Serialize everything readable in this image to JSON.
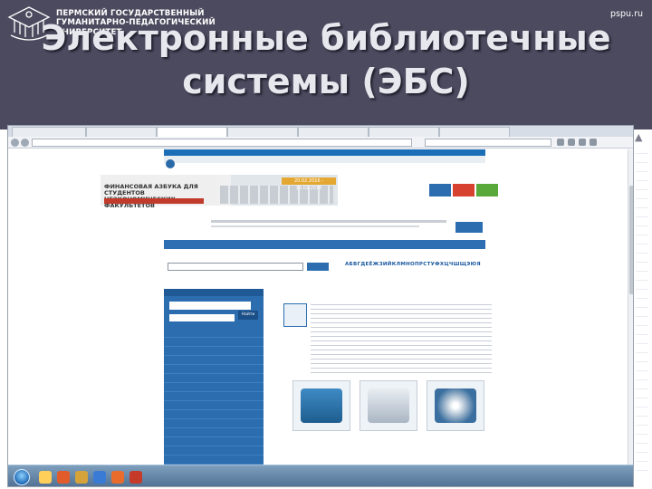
{
  "slide": {
    "university_name_lines": [
      "ПЕРМСКИЙ ГОСУДАРСТВЕННЫЙ",
      "ГУМАНИТАРНО-ПЕДАГОГИЧЕСКИЙ",
      "УНИВЕРСИТЕТ"
    ],
    "site": "pspu.ru",
    "title": "Электронные библиотечные системы (ЭБС)"
  },
  "browser": {
    "tabs": [
      "",
      "",
      "",
      "",
      "",
      "",
      ""
    ],
    "url": "",
    "search_placeholder": ""
  },
  "page": {
    "top_banner": "",
    "header_text": "",
    "event_banner": {
      "kicker": "",
      "headline": "ФИНАНСОВАЯ АЗБУКА ДЛЯ СТУДЕНТОВ НЕЭКОНОМИЧЕСКИХ ФАКУЛЬТЕТОВ",
      "dates": "20.02.2016 - 10.02.2016"
    },
    "colored_buttons": [
      "",
      "",
      ""
    ],
    "info_heading": "",
    "info_button": "",
    "main_nav_items": [
      "",
      "",
      "",
      "",
      "",
      "",
      "",
      "",
      ""
    ],
    "search": {
      "label": "",
      "button": "",
      "options": ""
    },
    "alphabet": {
      "label": "",
      "letters": "АБВГДЕЁЖЗИЙКЛМНОПРСТУФХЦЧШЩЭЮЯ",
      "tabs": ""
    },
    "left_panel": {
      "header": "",
      "search_value": "",
      "select_value": "",
      "button": "Найти",
      "items": [
        "",
        "",
        "",
        "",
        "",
        "",
        "",
        "",
        "",
        "",
        "",
        "",
        "",
        "",
        "",
        "",
        "",
        "",
        "",
        ""
      ]
    },
    "article_title": "",
    "tiles": [
      {
        "caption": ""
      },
      {
        "caption": ""
      },
      {
        "caption": ""
      }
    ]
  },
  "taskbar": {
    "clock_time": "",
    "clock_date": ""
  },
  "colors": {
    "header_bg": "#4c4a5e",
    "portal_blue": "#2c6db0",
    "btn_blue": "#2c6db0",
    "btn_red": "#d7412f",
    "btn_green": "#59a83a"
  }
}
